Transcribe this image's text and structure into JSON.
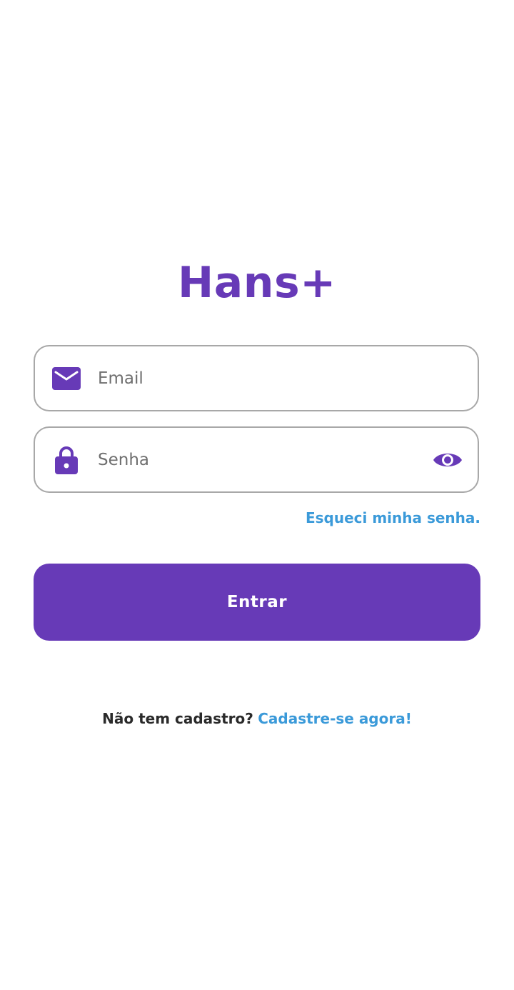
{
  "app": {
    "title": "Hans+"
  },
  "login_form": {
    "email": {
      "placeholder": "Email",
      "value": "",
      "icon": "mail-icon"
    },
    "password": {
      "placeholder": "Senha",
      "value": "",
      "icon": "lock-icon",
      "toggle_icon": "eye-icon"
    },
    "forgot_password_label": "Esqueci minha senha.",
    "submit_label": "Entrar"
  },
  "signup": {
    "prompt": "Não tem cadastro?",
    "link_label": "Cadastre-se agora!"
  },
  "colors": {
    "primary": "#673ab7",
    "link": "#3b9ad9",
    "border": "#a8a8a8"
  }
}
